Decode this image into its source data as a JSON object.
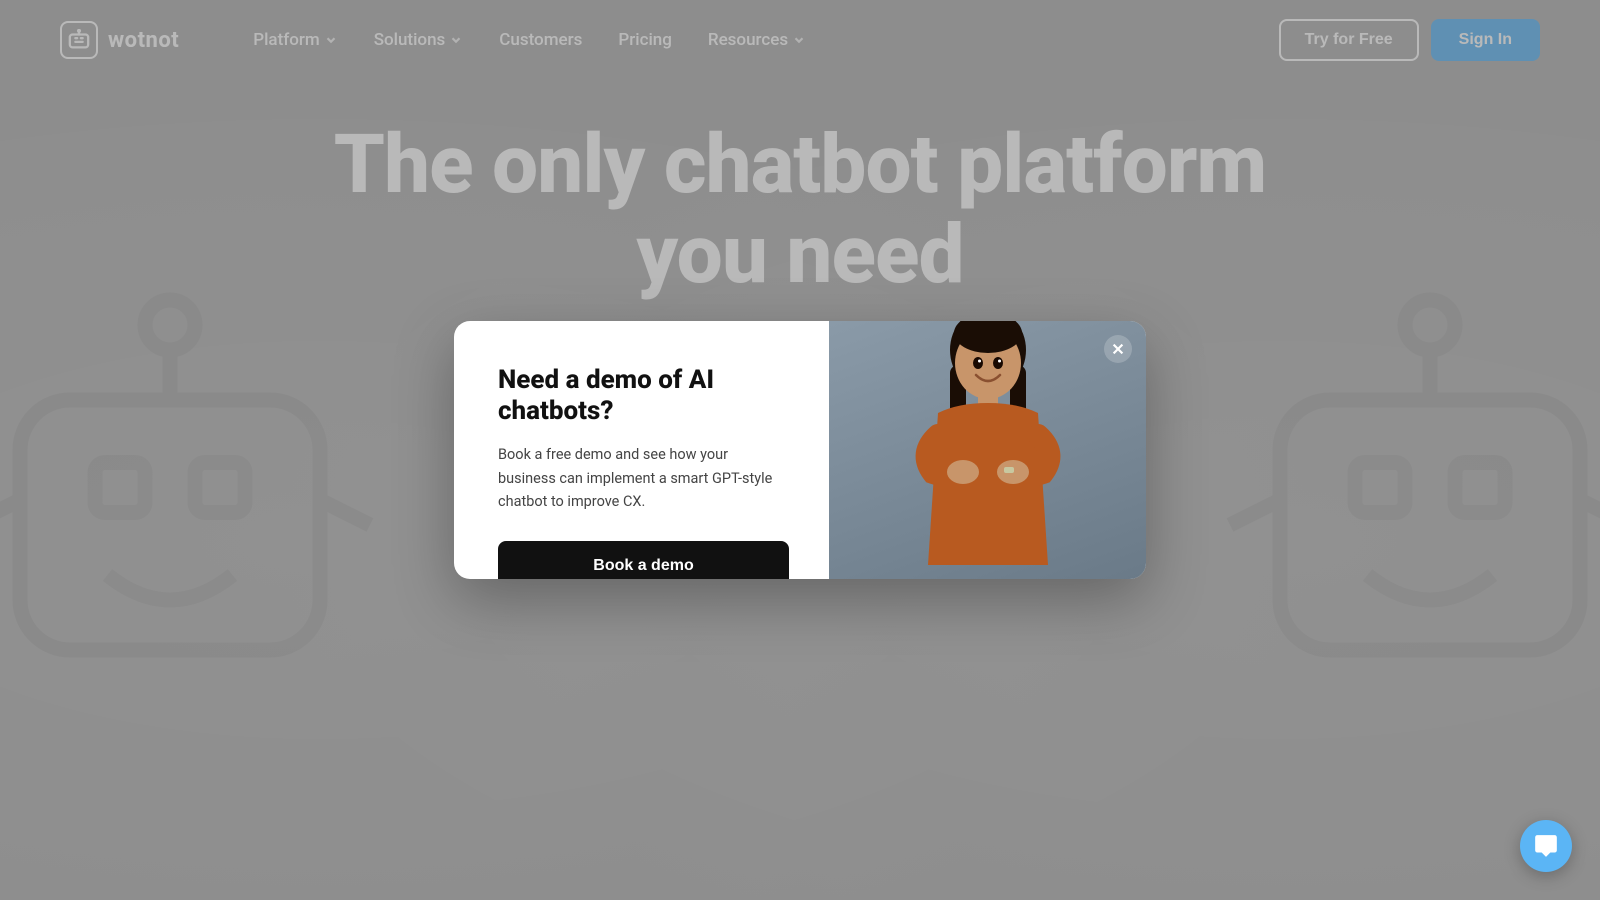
{
  "site": {
    "name": "wotnot"
  },
  "navbar": {
    "logo_text": "wotnot",
    "nav_items": [
      {
        "label": "Platform",
        "has_dropdown": true
      },
      {
        "label": "Solutions",
        "has_dropdown": true
      },
      {
        "label": "Customers",
        "has_dropdown": false
      },
      {
        "label": "Pricing",
        "has_dropdown": false
      },
      {
        "label": "Resources",
        "has_dropdown": true
      }
    ],
    "try_button_label": "Try for Free",
    "signin_button_label": "Sign In"
  },
  "hero": {
    "headline_line1": "The only chatbot platform",
    "headline_line2": "you need"
  },
  "modal": {
    "title": "Need a demo of AI chatbots?",
    "description": "Book a free demo and see how your business can implement a smart GPT-style chatbot to improve CX.",
    "cta_button_label": "Book a demo",
    "close_label": "×"
  },
  "chat_widget": {
    "icon": "chat"
  },
  "colors": {
    "bg": "#b2b2b2",
    "nav_bg": "transparent",
    "btn_try_border": "#ffffff",
    "btn_signin_bg": "#5bb5f5",
    "modal_bg": "#ffffff",
    "modal_right_bg": "#7d8e98",
    "cta_bg": "#111111",
    "chat_bubble_bg": "#5bb5f5"
  }
}
